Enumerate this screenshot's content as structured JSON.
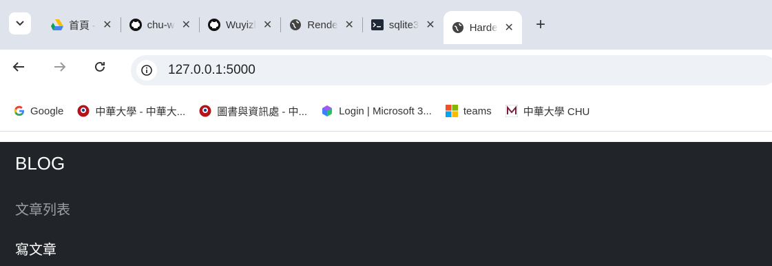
{
  "browser": {
    "tabs": [
      {
        "label": "首頁 - ",
        "icon": "google-drive-icon"
      },
      {
        "label": "chu-w",
        "icon": "github-icon"
      },
      {
        "label": "Wuyizl",
        "icon": "github-icon"
      },
      {
        "label": "Rende",
        "icon": "globe-icon"
      },
      {
        "label": "sqlite3",
        "icon": "terminal-icon"
      },
      {
        "label": "Harde",
        "icon": "globe-icon",
        "active": true
      }
    ],
    "close_glyph": "✕",
    "new_tab_glyph": "+",
    "menu_glyph": "⌄",
    "url": "127.0.0.1:5000",
    "bookmarks": [
      {
        "label": "Google",
        "icon": "google-icon"
      },
      {
        "label": "中華大學 - 中華大...",
        "icon": "chu-logo-icon"
      },
      {
        "label": "圖書與資訊處 - 中...",
        "icon": "chu-logo-icon"
      },
      {
        "label": "Login | Microsoft 3...",
        "icon": "microsoft-365-icon"
      },
      {
        "label": "teams",
        "icon": "microsoft-icon"
      },
      {
        "label": "中華大學 CHU",
        "icon": "m-logo-icon"
      }
    ]
  },
  "page": {
    "brand": "BLOG",
    "nav": {
      "list": "文章列表",
      "write": "寫文章"
    }
  },
  "colors": {
    "navbar_bg": "#212529",
    "chrome_bg": "#dfe3ec"
  }
}
